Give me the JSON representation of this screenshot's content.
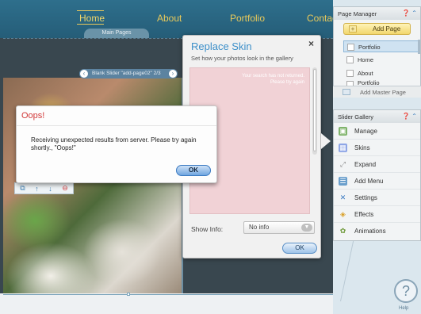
{
  "nav": {
    "items": [
      "Home",
      "About",
      "Portfolio",
      "Contac"
    ],
    "main_pages_tab": "Main Pages"
  },
  "slider_label": {
    "text": "Blank Slider \"add-page02\" 2/3",
    "prev_icon": "chevron-left-icon",
    "next_icon": "chevron-right-icon"
  },
  "replace_skin": {
    "title": "Replace Skin",
    "close": "×",
    "subtitle": "Set how your photos look in the gallery",
    "preview_text": "Your search has not returned. Please try again",
    "show_info_label": "Show Info:",
    "show_info_value": "No info",
    "ok": "OK"
  },
  "oops": {
    "title": "Oops!",
    "message": "Receiving unexpected results from server. Please try again shortly., \"Oops!\"",
    "ok": "OK"
  },
  "mini_toolbar": {
    "icons": [
      "copy-icon",
      "arrow-up-icon",
      "arrow-down-icon",
      "delete-icon"
    ]
  },
  "page_manager": {
    "title": "Page Manager",
    "add_page": "Add Page",
    "pages": [
      "Portfolio",
      "Home",
      "About",
      "Portfolio"
    ],
    "master": "Add Master Page"
  },
  "slider_gallery": {
    "title": "Slider Gallery",
    "items": [
      "Manage",
      "Skins",
      "Expand",
      "Add Menu",
      "Settings",
      "Effects",
      "Animations"
    ]
  },
  "help": {
    "label": "Help"
  },
  "colors": {
    "nav_bg": "#2e6f8c",
    "nav_text": "#f0d66a",
    "accent_blue": "#3c8fc9",
    "error_red": "#d13838"
  }
}
